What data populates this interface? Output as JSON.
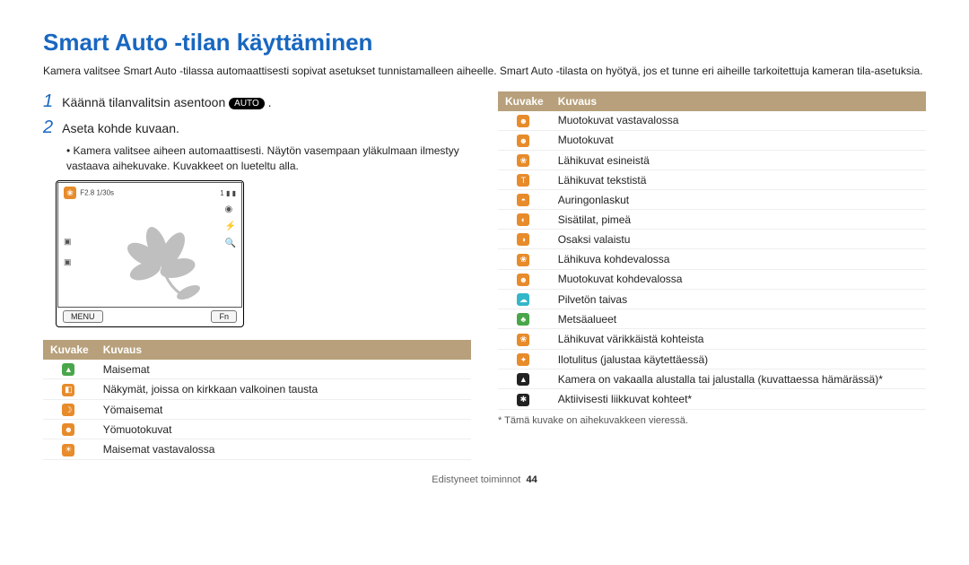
{
  "title": "Smart Auto -tilan käyttäminen",
  "intro": "Kamera valitsee Smart Auto -tilassa automaattisesti sopivat asetukset tunnistamalleen aiheelle. Smart Auto -tilasta on hyötyä, jos et tunne eri aiheille tarkoitettuja kameran tila-asetuksia.",
  "step1_num": "1",
  "step1_text_a": "Käännä tilanvalitsin asentoon ",
  "step1_badge": "AUTO",
  "step1_text_b": " .",
  "step2_num": "2",
  "step2_text": "Aseta kohde kuvaan.",
  "bullet1": "Kamera valitsee aiheen automaattisesti. Näytön vasempaan yläkulmaan ilmestyy vastaava aihekuvake. Kuvakkeet on lueteltu alla.",
  "lcd": {
    "aperture": "F2.8",
    "shutter": "1/30s",
    "count": "1",
    "menu": "MENU",
    "fn": "Fn"
  },
  "th_kuvake": "Kuvake",
  "th_kuvaus": "Kuvaus",
  "left": [
    {
      "cls": "green",
      "glyph": "▲",
      "txt": "Maisemat"
    },
    {
      "cls": "orange",
      "glyph": "◧",
      "txt": "Näkymät, joissa on kirkkaan valkoinen tausta"
    },
    {
      "cls": "orange",
      "glyph": "☽",
      "txt": "Yömaisemat"
    },
    {
      "cls": "orange",
      "glyph": "☻",
      "txt": "Yömuotokuvat"
    },
    {
      "cls": "orange",
      "glyph": "☀",
      "txt": "Maisemat vastavalossa"
    }
  ],
  "right": [
    {
      "cls": "orange",
      "glyph": "☻",
      "txt": "Muotokuvat vastavalossa"
    },
    {
      "cls": "orange",
      "glyph": "☻",
      "txt": "Muotokuvat"
    },
    {
      "cls": "orange",
      "glyph": "❀",
      "txt": "Lähikuvat esineistä"
    },
    {
      "cls": "orange",
      "glyph": "T",
      "txt": "Lähikuvat tekstistä"
    },
    {
      "cls": "orange",
      "glyph": "◓",
      "txt": "Auringonlaskut"
    },
    {
      "cls": "orange",
      "glyph": "◐",
      "txt": "Sisätilat, pimeä"
    },
    {
      "cls": "orange",
      "glyph": "◑",
      "txt": "Osaksi valaistu"
    },
    {
      "cls": "orange",
      "glyph": "❀",
      "txt": "Lähikuva kohdevalossa"
    },
    {
      "cls": "orange",
      "glyph": "☻",
      "txt": "Muotokuvat kohdevalossa"
    },
    {
      "cls": "cyan",
      "glyph": "☁",
      "txt": "Pilvetön taivas"
    },
    {
      "cls": "green",
      "glyph": "♣",
      "txt": "Metsäalueet"
    },
    {
      "cls": "orange",
      "glyph": "❀",
      "txt": "Lähikuvat värikkäistä kohteista"
    },
    {
      "cls": "orange",
      "glyph": "✦",
      "txt": "Ilotulitus (jalustaa käytettäessä)"
    },
    {
      "cls": "black",
      "glyph": "▲",
      "txt": "Kamera on vakaalla alustalla tai jalustalla (kuvattaessa hämärässä)*"
    },
    {
      "cls": "black",
      "glyph": "✱",
      "txt": "Aktiivisesti liikkuvat kohteet*"
    }
  ],
  "note": "* Tämä kuvake on aihekuvakkeen vieressä.",
  "footer_text": "Edistyneet toiminnot",
  "footer_page": "44"
}
